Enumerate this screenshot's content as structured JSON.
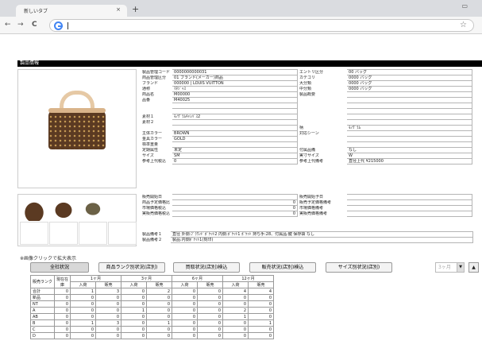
{
  "browser": {
    "tab_title": "新しいタブ",
    "tab_close": "×",
    "new_tab": "+",
    "window_control": "▭",
    "back": "←",
    "forward": "→",
    "reload": "C",
    "url": "",
    "star": "☆"
  },
  "header": {
    "title": "製品情報"
  },
  "left_fields": [
    {
      "label": "製品管理コード",
      "value": "0000000000031",
      "extra_label": "ＪＡＮコード",
      "extra_value": ""
    },
    {
      "label": "商品管理区分",
      "value": "01 ブランド(メーカー)商品"
    },
    {
      "label": "ブランド",
      "value": "000000 | LOUIS VUITTON"
    },
    {
      "label": "通称",
      "value": "ﾏﾈｼﾞｬｽ"
    },
    {
      "label": "商品名",
      "value": "M00000"
    },
    {
      "label": "品番",
      "value": "M40025"
    },
    {
      "label": "",
      "value": ""
    },
    {
      "label": "",
      "value": ""
    },
    {
      "label": "素材１",
      "value": "ﾓﾉｸﾞﾗﾑｷｬﾝﾊﾞｽ2"
    },
    {
      "label": "素材２",
      "value": ""
    },
    {
      "label": "",
      "value": ""
    },
    {
      "label": "主体カラー",
      "value": "BROWN"
    },
    {
      "label": "金具カラー",
      "value": "GOLD"
    },
    {
      "label": "標準重量",
      "value": ""
    },
    {
      "label": "定期属性",
      "value": "未定"
    },
    {
      "label": "サイズ",
      "value": "SM",
      "extra": "SM"
    },
    {
      "label": "参考上代税込",
      "value": "0",
      "mid_label": "参考上代更新日",
      "mid_value": "2014/10/20"
    }
  ],
  "right_fields": [
    {
      "label": "エントリ区分",
      "value": "00 バッグ"
    },
    {
      "label": "カテゴリ",
      "value": "0000 バッグ"
    },
    {
      "label": "大分類",
      "value": "0000 バッグ"
    },
    {
      "label": "中分類",
      "value": "0000 バッグ"
    },
    {
      "label": "製品概要",
      "value": ""
    },
    {
      "label": "",
      "value": ""
    },
    {
      "label": "",
      "value": ""
    },
    {
      "label": "",
      "value": ""
    },
    {
      "label": "",
      "value": ""
    },
    {
      "label": "",
      "value": ""
    },
    {
      "label": "柄",
      "value": "ﾓﾉｸﾞﾗﾑ"
    },
    {
      "label": "対応シーン",
      "value": ""
    },
    {
      "label": "",
      "value": ""
    },
    {
      "label": "",
      "value": ""
    },
    {
      "label": "付属品備",
      "value": "なし"
    },
    {
      "label": "実寸サイズ",
      "value": "W",
      "w": "38",
      "h": "26",
      "d": "14"
    },
    {
      "label": "参考上代備考",
      "value": "直径上代 ¥215000"
    }
  ],
  "sales_left": [
    {
      "label": "販売開始日",
      "value": ""
    },
    {
      "label": "商品予定価格比",
      "value": "0",
      "mid": "商品予定価格日"
    },
    {
      "label": "市場価格税込",
      "value": "0",
      "mid": "市場価格更新日"
    },
    {
      "label": "実販売価格税込",
      "value": "0",
      "mid": "実販売価格更新日"
    }
  ],
  "sales_right": [
    {
      "label": "販売開始予日",
      "value": ""
    },
    {
      "label": "販売予定価格備考",
      "value": ""
    },
    {
      "label": "市場価格備考",
      "value": ""
    },
    {
      "label": "実販売価格備考",
      "value": ""
    }
  ],
  "notes": [
    {
      "label": "製品備考１",
      "value": "直径 外側:ﾌﾞﾗｳﾝﾄﾞﾎﾟｹｯﾄ2 内側:ﾎﾟｹｯﾄ1 ﾎﾟｹｯﾄ 持ち手:28、付属品:鍵 保存袋 なし"
    },
    {
      "label": "製品備考２",
      "value": "製品:内側ﾎﾟｹｯﾄ1(刻印)"
    }
  ],
  "click_note": "※画像クリックで拡大表示",
  "buttons": [
    {
      "label": "全社状況",
      "active": true
    },
    {
      "label": "商品ランク別状況(店別)",
      "active": false
    },
    {
      "label": "買取状況(店別)検込",
      "active": false
    },
    {
      "label": "販売状況(店別)検込",
      "active": false
    },
    {
      "label": "サイズ別状況(店別)",
      "active": false
    }
  ],
  "month_select": "3ヶ月",
  "up_button": "▲",
  "stock_table": {
    "rank_header": "販売ランク",
    "stock_header": "現在在庫",
    "periods": [
      "1ヶ月",
      "3ヶ月",
      "6ヶ月",
      "12ヶ月"
    ],
    "sub_headers": [
      "入荷",
      "販売"
    ],
    "rows": [
      {
        "rank": "合計",
        "stock": "0",
        "vals": [
          "1",
          "3",
          "0",
          "2",
          "0",
          "0",
          "4",
          "4"
        ]
      },
      {
        "rank": "新品",
        "stock": "0",
        "vals": [
          "0",
          "0",
          "0",
          "0",
          "0",
          "0",
          "0",
          "0"
        ]
      },
      {
        "rank": "NT",
        "stock": "0",
        "vals": [
          "0",
          "0",
          "0",
          "0",
          "0",
          "0",
          "0",
          "0"
        ]
      },
      {
        "rank": "A",
        "stock": "0",
        "vals": [
          "0",
          "0",
          "1",
          "0",
          "0",
          "0",
          "2",
          "0"
        ]
      },
      {
        "rank": "AB",
        "stock": "0",
        "vals": [
          "0",
          "0",
          "0",
          "0",
          "0",
          "0",
          "1",
          "0"
        ]
      },
      {
        "rank": "B",
        "stock": "0",
        "vals": [
          "1",
          "3",
          "0",
          "1",
          "0",
          "0",
          "0",
          "1"
        ]
      },
      {
        "rank": "C",
        "stock": "0",
        "vals": [
          "0",
          "0",
          "0",
          "0",
          "0",
          "0",
          "0",
          "0"
        ]
      },
      {
        "rank": "D",
        "stock": "0",
        "vals": [
          "0",
          "0",
          "0",
          "0",
          "0",
          "0",
          "0",
          "0"
        ]
      }
    ]
  }
}
